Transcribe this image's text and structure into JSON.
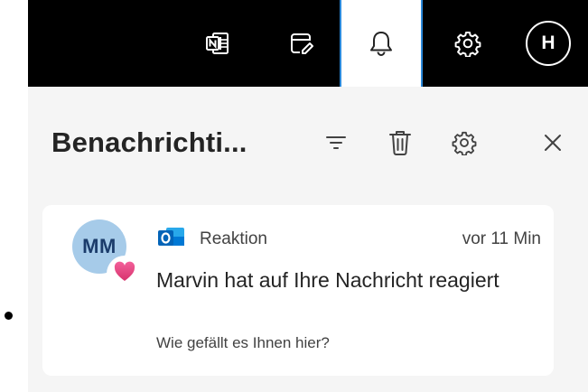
{
  "topbar": {
    "icons": [
      "onenote-icon",
      "todo-icon",
      "bell-icon",
      "gear-icon"
    ],
    "user_initial": "H",
    "active_accent": "#2b88d8"
  },
  "panel": {
    "title": "Benachrichti...",
    "actions": [
      "filter-icon",
      "trash-icon",
      "gear-icon",
      "close-icon"
    ]
  },
  "notification": {
    "avatar_initials": "MM",
    "reaction_icon": "heart-icon",
    "app_icon": "outlook-icon",
    "app_label": "Reaktion",
    "timestamp": "vor 11 Min",
    "title": "Marvin hat auf Ihre Nachricht reagiert",
    "preview": "Wie gefällt es Ihnen hier?"
  }
}
